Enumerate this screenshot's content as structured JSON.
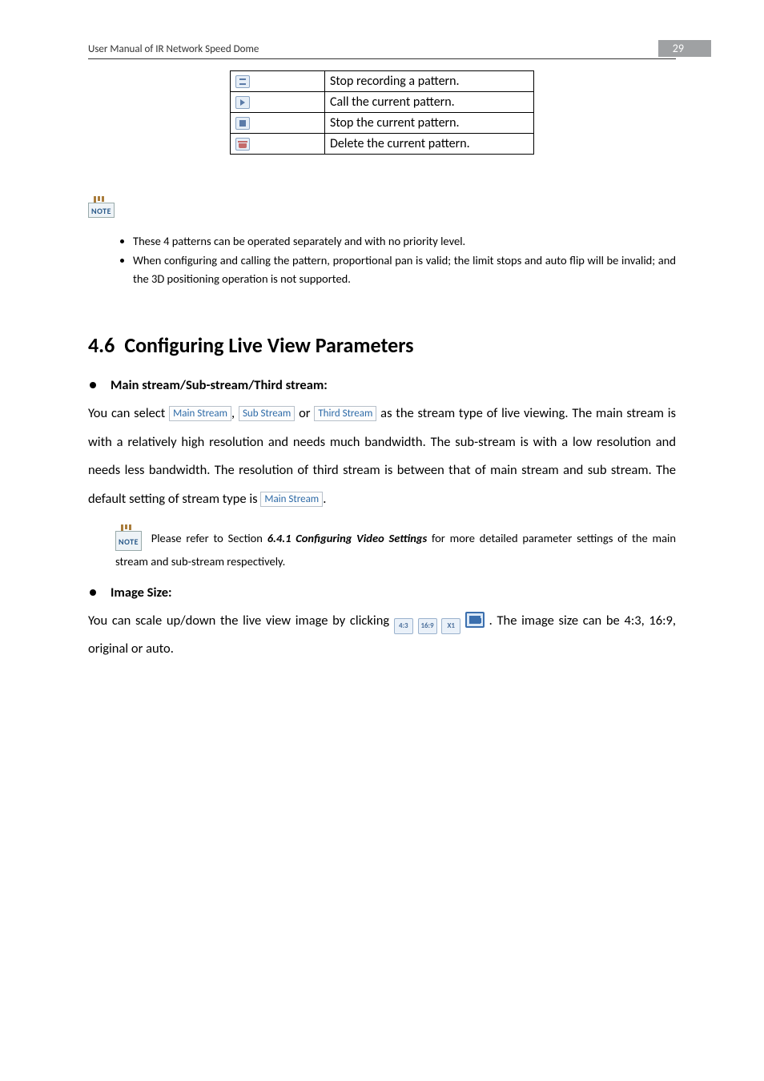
{
  "header": {
    "title": "User Manual of IR Network Speed Dome",
    "page": "29"
  },
  "table": {
    "rows": [
      {
        "desc": "Stop recording a pattern."
      },
      {
        "desc": "Call the current pattern."
      },
      {
        "desc": "Stop the current pattern."
      },
      {
        "desc": "Delete the current pattern."
      }
    ]
  },
  "note_label": "NOTE",
  "notes": {
    "b1": "These 4 patterns can be operated separately and with no priority level.",
    "b2": "When configuring and calling the pattern, proportional pan is valid; the limit stops and auto flip will be invalid; and the 3D positioning operation is not supported."
  },
  "section": {
    "num": "4.6",
    "title": "Configuring Live View Parameters"
  },
  "stream": {
    "heading": "Main stream/Sub-stream/Third stream:",
    "p_a": "You can select",
    "pill_main": "Main Stream",
    "p_b": ",",
    "pill_sub": "Sub Stream",
    "p_c": " or ",
    "pill_third": "Third Stream",
    "p_d": " as the stream type of live viewing. The main stream is with a relatively high resolution and needs much bandwidth. The sub-stream is with a low resolution and needs less bandwidth. The resolution of third stream is between that of main stream and sub stream. The default setting of stream type is",
    "p_e": "."
  },
  "stream_note": {
    "a": " Please refer to Section ",
    "ref": "6.4.1 Configuring Video Settings",
    "b": " for more detailed parameter settings of the main stream and sub-stream respectively."
  },
  "imgsize": {
    "heading": "Image Size:",
    "p_a": "You can scale up/down the live view image by clicking ",
    "b43": "4:3",
    "b169": "16:9",
    "bx1": "X1",
    "p_b": ". The image size can be 4:3, 16:9, original or auto."
  }
}
